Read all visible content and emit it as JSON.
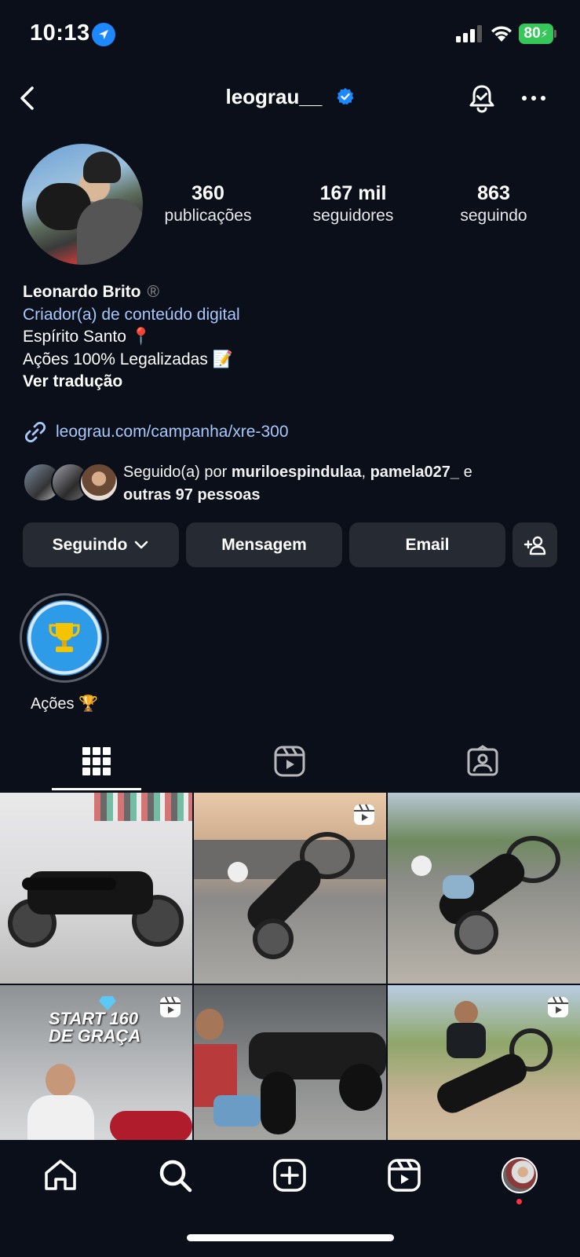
{
  "status_bar": {
    "time": "10:13",
    "battery": "80"
  },
  "header": {
    "username": "leograu__"
  },
  "stats": [
    {
      "value": "360",
      "label": "publicações"
    },
    {
      "value": "167 mil",
      "label": "seguidores"
    },
    {
      "value": "863",
      "label": "seguindo"
    }
  ],
  "bio": {
    "name": "Leonardo Brito",
    "reg_mark": "®",
    "category": "Criador(a) de conteúdo digital",
    "line1": "Espírito Santo 📍",
    "line2": "Ações 100% Legalizadas 📝",
    "translate": "Ver tradução",
    "link": "leograu.com/campanha/xre-300"
  },
  "followed_by": {
    "prefix": "Seguido(a) por ",
    "user1": "muriloespindulaa",
    "sep": ", ",
    "user2": "pamela027_",
    "conj": " e",
    "others": "outras 97 pessoas"
  },
  "buttons": {
    "following": "Seguindo",
    "message": "Mensagem",
    "email": "Email"
  },
  "highlights": [
    {
      "label": "Ações 🏆"
    }
  ],
  "grid": {
    "post4_text_line1": "START 160",
    "post4_text_line2": "DE GRAÇA"
  },
  "colors": {
    "background": "#0b0f19",
    "link": "#a8c7fa",
    "button": "#262a33",
    "verified": "#1e88ff"
  }
}
